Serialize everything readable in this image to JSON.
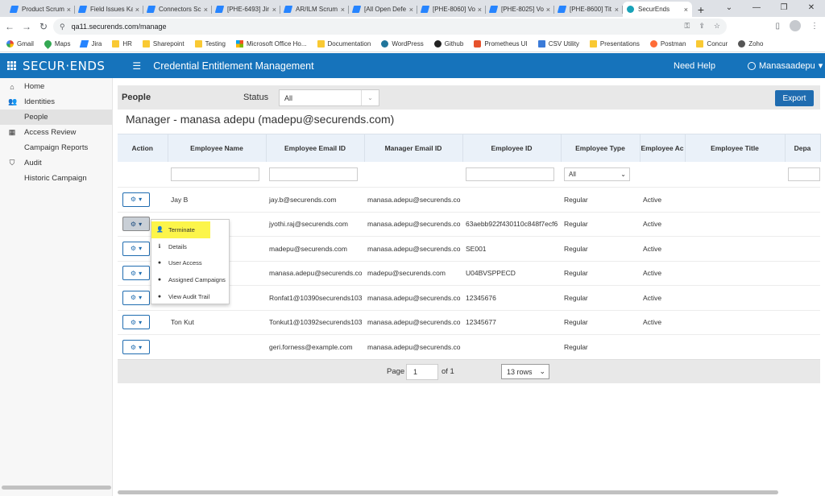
{
  "browser": {
    "tabs": [
      {
        "label": "Product Scrum",
        "icon": "jira-icon"
      },
      {
        "label": "Field Issues Ka",
        "icon": "jira-icon"
      },
      {
        "label": "Connectors Sc",
        "icon": "jira-icon"
      },
      {
        "label": "[PHE-6493] Jir",
        "icon": "jira-icon"
      },
      {
        "label": "AR/ILM Scrum",
        "icon": "jira-icon"
      },
      {
        "label": "[All Open Defe",
        "icon": "jira-icon"
      },
      {
        "label": "[PHE-8060] Vo",
        "icon": "jira-icon"
      },
      {
        "label": "[PHE-8025] Vo",
        "icon": "jira-icon"
      },
      {
        "label": "[PHE-8600] Tit",
        "icon": "jira-icon"
      },
      {
        "label": "SecurEnds",
        "icon": "securends-icon",
        "active": true
      }
    ],
    "url": "qa11.securends.com/manage",
    "bookmarks": [
      {
        "label": "Gmail",
        "icon": "g"
      },
      {
        "label": "Maps",
        "icon": "maps"
      },
      {
        "label": "Jira",
        "icon": "jira"
      },
      {
        "label": "HR",
        "icon": "folder"
      },
      {
        "label": "Sharepoint",
        "icon": "folder"
      },
      {
        "label": "Testing",
        "icon": "folder"
      },
      {
        "label": "Microsoft Office Ho...",
        "icon": "ms"
      },
      {
        "label": "Documentation",
        "icon": "folder"
      },
      {
        "label": "WordPress",
        "icon": "wp"
      },
      {
        "label": "Github",
        "icon": "gh"
      },
      {
        "label": "Prometheus UI",
        "icon": "pro"
      },
      {
        "label": "CSV Utility",
        "icon": "csv"
      },
      {
        "label": "Presentations",
        "icon": "folder"
      },
      {
        "label": "Postman",
        "icon": "pm"
      },
      {
        "label": "Concur",
        "icon": "folder"
      },
      {
        "label": "Zoho",
        "icon": "zoho"
      }
    ]
  },
  "header": {
    "logo": "SECUR·ENDS",
    "title": "Credential Entitlement Management",
    "help": "Need Help",
    "user": "Manasaadepu"
  },
  "sidebar": [
    {
      "label": "Home",
      "icon": "home-icon",
      "glyph": "⌂",
      "level": 0
    },
    {
      "label": "Identities",
      "icon": "users-icon",
      "glyph": "👥",
      "level": 0
    },
    {
      "label": "People",
      "level": 1,
      "active": true
    },
    {
      "label": "Access Review",
      "icon": "grid-icon",
      "glyph": "▦",
      "level": 0
    },
    {
      "label": "Campaign Reports",
      "level": 1
    },
    {
      "label": "Audit",
      "icon": "shield-icon",
      "glyph": "⛉",
      "level": 0
    },
    {
      "label": "Historic Campaign",
      "level": 1
    }
  ],
  "toolbar": {
    "page_title": "People",
    "status_label": "Status",
    "status_value": "All",
    "export_label": "Export"
  },
  "manager_heading": "Manager - manasa adepu (madepu@securends.com)",
  "table": {
    "columns": [
      "Action",
      "Employee Name",
      "Employee Email ID",
      "Manager Email ID",
      "Employee ID",
      "Employee Type",
      "Employee Ac",
      "Employee Title",
      "Depa"
    ],
    "type_filter": "All",
    "rows": [
      {
        "name": "Jay B",
        "email": "jay.b@securends.com",
        "manager": "manasa.adepu@securends.co",
        "id": "",
        "type": "Regular",
        "status": "Active"
      },
      {
        "name": "",
        "email": "jyothi.raj@securends.com",
        "manager": "manasa.adepu@securends.co",
        "id": "63aebb922f430110c848f7ecf6",
        "type": "Regular",
        "status": "Active"
      },
      {
        "name": "",
        "email": "madepu@securends.com",
        "manager": "manasa.adepu@securends.co",
        "id": "SE001",
        "type": "Regular",
        "status": "Active"
      },
      {
        "name": "",
        "email": "manasa.adepu@securends.co",
        "manager": "madepu@securends.com",
        "id": "U04BVSPPECD",
        "type": "Regular",
        "status": "Active"
      },
      {
        "name": "",
        "email": "Ronfat1@10390securends103",
        "manager": "manasa.adepu@securends.co",
        "id": "12345676",
        "type": "Regular",
        "status": "Active"
      },
      {
        "name": "Ton Kut",
        "email": "Tonkut1@10392securends103",
        "manager": "manasa.adepu@securends.co",
        "id": "12345677",
        "type": "Regular",
        "status": "Active"
      },
      {
        "name": "",
        "email": "geri.forness@example.com",
        "manager": "manasa.adepu@securends.co",
        "id": "",
        "type": "Regular",
        "status": ""
      }
    ]
  },
  "action_menu": [
    {
      "label": "Terminate",
      "icon": "user-minus-icon",
      "glyph": "👤",
      "highlighted": true
    },
    {
      "label": "Details",
      "icon": "info-icon",
      "glyph": "ℹ"
    },
    {
      "label": "User Access",
      "icon": "info-circle-icon",
      "glyph": "●"
    },
    {
      "label": "Assigned Campaigns",
      "icon": "info-circle-icon",
      "glyph": "●"
    },
    {
      "label": "View Audit Trail",
      "icon": "info-circle-icon",
      "glyph": "●"
    }
  ],
  "pager": {
    "page_label": "Page",
    "page_value": "1",
    "of_label": "of 1",
    "rows_value": "13 rows"
  },
  "colors": {
    "header_blue": "#1673bb",
    "button_blue": "#1f6cb0",
    "highlight_yellow": "#fcf54a"
  }
}
